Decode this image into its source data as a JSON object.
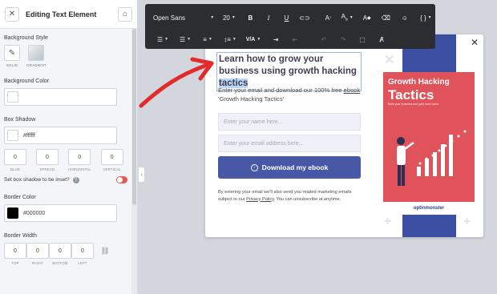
{
  "panel": {
    "title": "Editing Text Element",
    "background_style": {
      "label": "Background Style",
      "options": [
        "SOLID",
        "GRADIENT"
      ]
    },
    "background_color": {
      "label": "Background Color",
      "value": ""
    },
    "box_shadow": {
      "label": "Box Shadow",
      "color": "#ffffff",
      "values": [
        "0",
        "0",
        "0",
        "0"
      ],
      "captions": [
        "BLUR",
        "SPREAD",
        "HORIZONTAL",
        "VERTICAL"
      ],
      "inset_label": "Set box shadow to be inset?",
      "inset_toggle_color": "#e85a4f"
    },
    "border_color": {
      "label": "Border Color",
      "value": "#000000"
    },
    "border_width": {
      "label": "Border Width",
      "values": [
        "0",
        "0",
        "0",
        "0"
      ],
      "captions": [
        "TOP",
        "RIGHT",
        "BOTTOM",
        "LEFT"
      ]
    }
  },
  "toolbar": {
    "font_family": "Open Sans",
    "font_size": "20",
    "bold": "B",
    "italic": "I",
    "underline": "U",
    "font_color": "A",
    "font_size_icon": "A",
    "variable": "{ }",
    "letter_spacing": "V/A"
  },
  "popup": {
    "headline_plain": "Learn how to grow your business using growth hacking ",
    "headline_selected": "tactics",
    "description_pre": "Enter your email and download our 100% free ",
    "description_link": "ebook",
    "description_post": " 'Growth Hacking Tactics'",
    "name_placeholder": "Enter your name here...",
    "email_placeholder": "Enter your email address here...",
    "cta_label": "Download my ebook",
    "fine_pre": "By entering your email we'll also send you related marketing emails subject to our ",
    "fine_link": "Privacy Policy",
    "fine_post": ". You can unsubscribe at anytime.",
    "ebook": {
      "title_line1": "Growth Hacking",
      "title_line2": "Tactics",
      "subtitle": "Build your business and gain more users",
      "brand": "optinmonster"
    }
  },
  "colors": {
    "accent_blue": "#4858a6",
    "ebook_red": "#e0535a",
    "arrow_red": "#e22b2b",
    "toolbar_bg": "#2c2d30"
  }
}
